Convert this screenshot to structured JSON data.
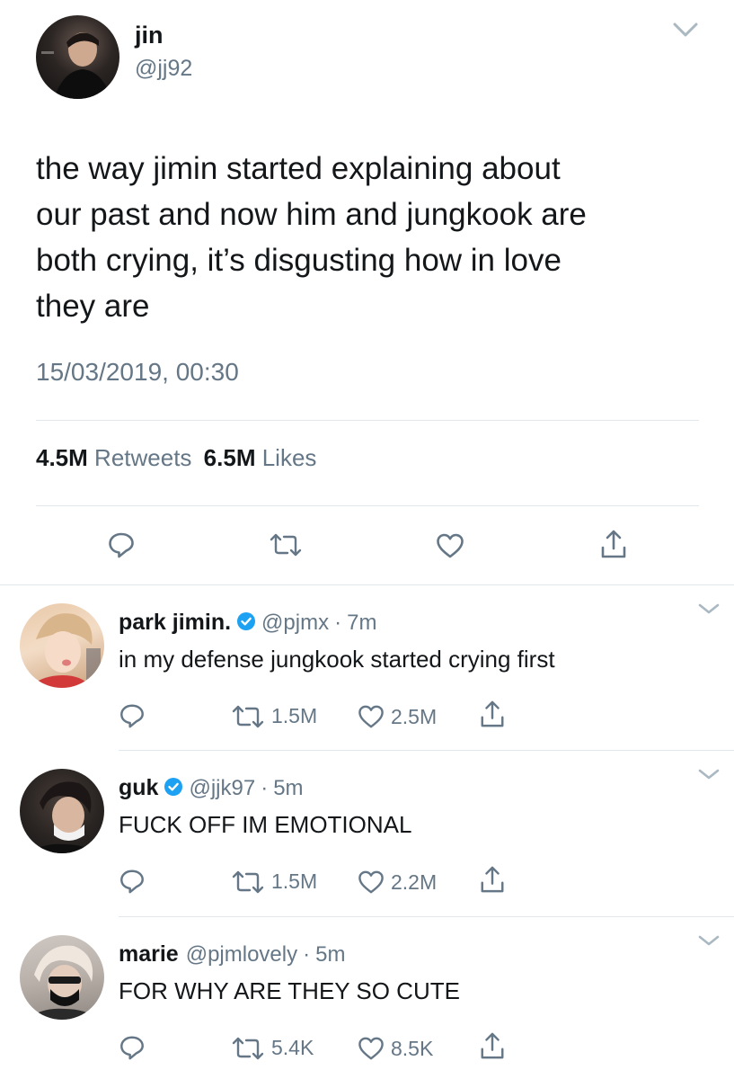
{
  "main_tweet": {
    "name": "jin",
    "handle": "@jj92",
    "text_lines": [
      "the way jimin started explaining about",
      "our past and now him and jungkook are",
      "both crying, it’s disgusting how in love",
      "they are"
    ],
    "timestamp": "15/03/2019, 00:30",
    "retweets_count": "4.5M",
    "retweets_label": "Retweets",
    "likes_count": "6.5M",
    "likes_label": "Likes"
  },
  "replies": [
    {
      "name": "park jimin.",
      "verified": true,
      "handle": "@pjmx",
      "time": "7m",
      "text": "in my defense jungkook started crying first",
      "retweets": "1.5M",
      "likes": "2.5M"
    },
    {
      "name": "guk",
      "verified": true,
      "handle": "@jjk97",
      "time": "5m",
      "text": "FUCK OFF IM EMOTIONAL",
      "retweets": "1.5M",
      "likes": "2.2M"
    },
    {
      "name": "marie",
      "verified": false,
      "handle": "@pjmlovely",
      "time": "5m",
      "text": "FOR WHY ARE THEY SO CUTE",
      "retweets": "5.4K",
      "likes": "8.5K"
    }
  ],
  "separator": "·",
  "colors": {
    "text": "#14171a",
    "muted": "#657786",
    "divider": "#e1e8ed",
    "verified": "#1da1f2"
  }
}
